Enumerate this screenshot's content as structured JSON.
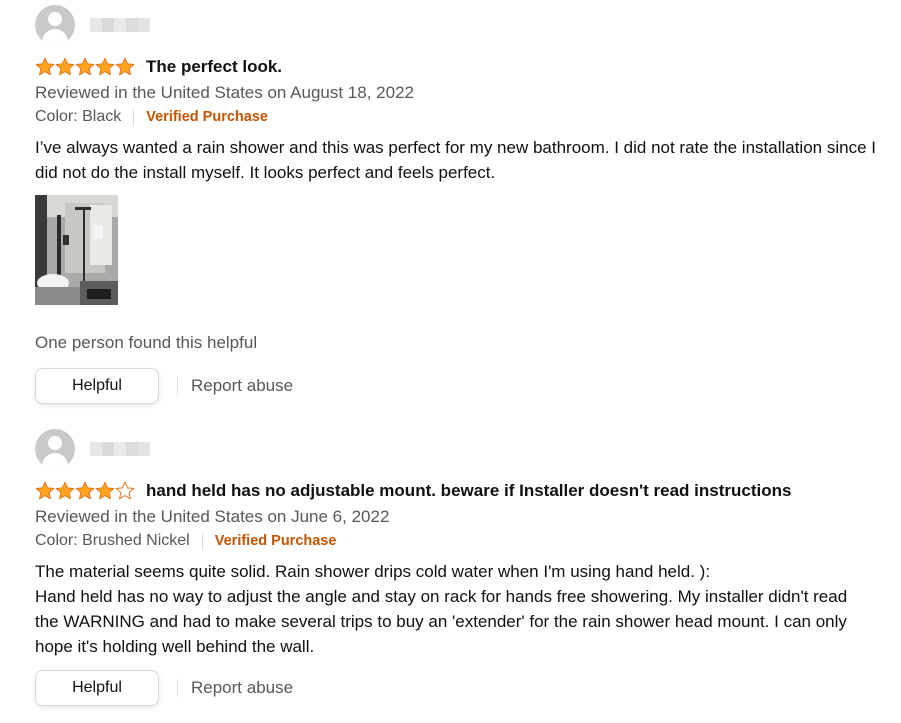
{
  "colors": {
    "star_fill": "#ffa41c",
    "star_stroke": "#de7921",
    "verified": "#c45500",
    "muted_text": "#565959",
    "body_text": "#0f1111"
  },
  "reviews": [
    {
      "avatar_icon": "default-user-avatar-icon",
      "rating": 5,
      "rating_max": 5,
      "title": "The perfect look.",
      "reviewed_line": "Reviewed in the United States on August 18, 2022",
      "variant": "Color: Black",
      "verified_label": "Verified Purchase",
      "body_lines": [
        "I’ve always wanted a rain shower and this was perfect for my new bathroom. I did not rate the installation since I did not do the install myself. It looks perfect and feels perfect."
      ],
      "has_photo": true,
      "helpful_count_text": "One person found this helpful",
      "helpful_button": "Helpful",
      "report_link": "Report abuse"
    },
    {
      "avatar_icon": "default-user-avatar-icon",
      "rating": 4,
      "rating_max": 5,
      "title": "hand held has no adjustable mount. beware if Installer doesn't read instructions",
      "reviewed_line": "Reviewed in the United States on June 6, 2022",
      "variant": "Color: Brushed Nickel",
      "verified_label": "Verified Purchase",
      "body_lines": [
        "The material seems quite solid. Rain shower drips cold water when I'm using hand held. ):",
        "Hand held has no way to adjust the angle and stay on rack for hands free showering. My installer didn't read the WARNING and had to make several trips to buy an 'extender' for the rain shower head mount. I can only hope it's holding well behind the wall."
      ],
      "has_photo": false,
      "helpful_button": "Helpful",
      "report_link": "Report abuse"
    }
  ]
}
